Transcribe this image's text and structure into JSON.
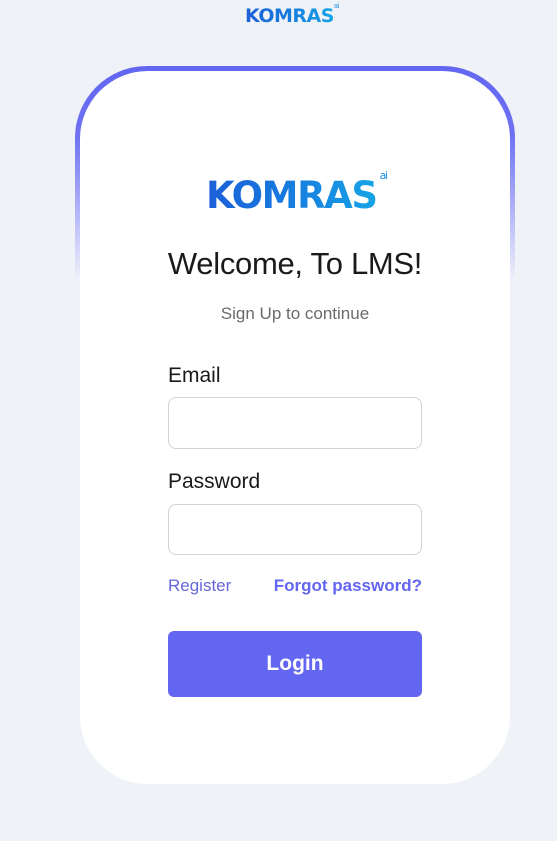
{
  "brand": {
    "name": "KOMRAS",
    "superscript": "ai"
  },
  "card": {
    "title": "Welcome, To LMS!",
    "subtitle": "Sign Up to continue"
  },
  "form": {
    "email_label": "Email",
    "email_value": "",
    "password_label": "Password",
    "password_value": "",
    "register_link": "Register",
    "forgot_link": "Forgot password?",
    "login_button": "Login"
  },
  "colors": {
    "accent": "#6366f1",
    "page_background": "#eff2f7",
    "logo_gradient_start": "#1d5fd8",
    "logo_gradient_end": "#16a4e6"
  }
}
